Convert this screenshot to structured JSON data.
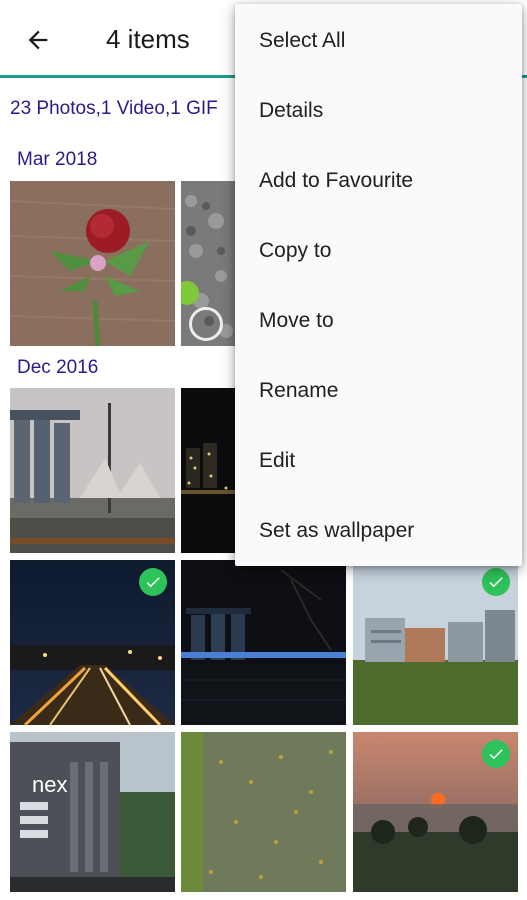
{
  "toolbar": {
    "back_icon": "arrow-back-icon",
    "title": "4 items"
  },
  "summary": "23 Photos,1 Video,1 GIF",
  "sections": [
    {
      "label": "Mar 2018"
    },
    {
      "label": "Dec 2016"
    }
  ],
  "thumbnails": [
    {
      "subject": "flower boutonniere on wood",
      "selected": false
    },
    {
      "subject": "gray foliage with ball",
      "selected": false,
      "video": true
    },
    {
      "subject": "city skyline daytime",
      "selected": false
    },
    {
      "subject": "night skyline",
      "selected": false
    },
    {
      "subject": "highway at night",
      "selected": true
    },
    {
      "subject": "waterfront at night",
      "selected": false
    },
    {
      "subject": "buildings and field",
      "selected": true
    },
    {
      "subject": "shopping mall building",
      "selected": false
    },
    {
      "subject": "path with yellow leaves",
      "selected": false
    },
    {
      "subject": "sunset landscape",
      "selected": true
    }
  ],
  "menu": {
    "items": [
      "Select All",
      "Details",
      "Add to Favourite",
      "Copy to",
      "Move to",
      "Rename",
      "Edit",
      "Set as wallpaper"
    ]
  },
  "colors": {
    "accent": "#1e9b8a",
    "header_text": "#2a1b8a",
    "check": "#2ec25a"
  }
}
